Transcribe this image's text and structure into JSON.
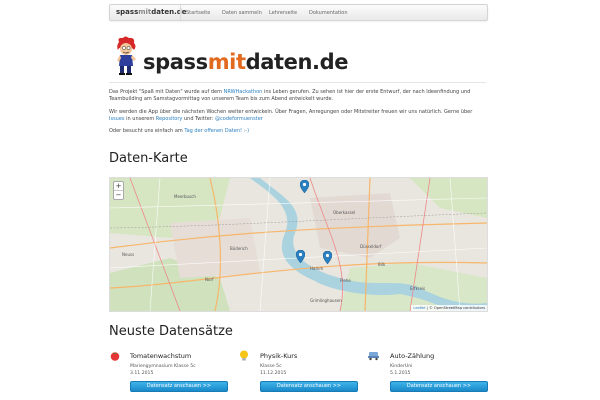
{
  "navbar": {
    "brand_part1": "spass",
    "brand_part2": "mit",
    "brand_part3": "daten.de",
    "links": [
      "Startseite",
      "Daten sammeln",
      "Lehrerseite",
      "Dokumentation"
    ]
  },
  "logo": {
    "part1": "spass",
    "part2": "mit",
    "part3": "daten.de"
  },
  "intro": {
    "p1_a": "Das Projekt \"Spaß mit Daten\" wurde auf dem ",
    "p1_link": "NRWHackathon",
    "p1_b": " ins Leben gerufen. Zu sehen ist hier der erste Entwurf, der nach Ideenfindung und Teambuilding am Samstagvormittag von unserem Team bis zum Abend entwickelt wurde.",
    "p2_a": "Wir werden die App über die nächsten Wochen weiter entwickeln. Über Fragen, Anregungen oder Mitstreiter freuen wir uns natürlich. Gerne über ",
    "p2_link1": "Issues",
    "p2_b": " in unserem ",
    "p2_link2": "Repository",
    "p2_c": " und Twitter: ",
    "p2_link3": "@codeformuenster",
    "p3_a": "Oder besucht uns einfach am ",
    "p3_link": "Tag der offenen Daten! :-)"
  },
  "map_section": {
    "title": "Daten-Karte",
    "zoom_in": "+",
    "zoom_out": "−",
    "attribution_leaflet": "Leaflet",
    "attribution_rest": " | © OpenStreetMap contributors",
    "labels": {
      "meerbusch": "Meerbusch",
      "neuss": "Neuss",
      "oberkassel": "Oberkassel",
      "dusseldorf": "Düsseldorf",
      "bilk": "Bilk",
      "flehe": "Flehe",
      "hamm": "Hamm",
      "norf": "Norf",
      "grimlinghausen": "Grimlinghausen",
      "erfkreis": "Erfkreis",
      "buderich": "Büderich"
    }
  },
  "datasets_section": {
    "title": "Neuste Datensätze",
    "items": [
      {
        "icon": "tomato-icon",
        "title": "Tomatenwachstum",
        "school": "Mariengymnasium Klasse 5c",
        "date": "3.11.2015",
        "button": "Datensatz anschauen >>",
        "color": "#e53535"
      },
      {
        "icon": "lightbulb-icon",
        "title": "Physik-Kurs",
        "school": "Klasse 5c",
        "date": "11.12.2015",
        "button": "Datensatz anschauen >>",
        "color": "#f5c518"
      },
      {
        "icon": "traffic-icon",
        "title": "Auto-Zählung",
        "school": "KinderUni",
        "date": "5.1.2015",
        "button": "Datensatz anschauen >>",
        "color": "#7aa6d8"
      }
    ]
  }
}
